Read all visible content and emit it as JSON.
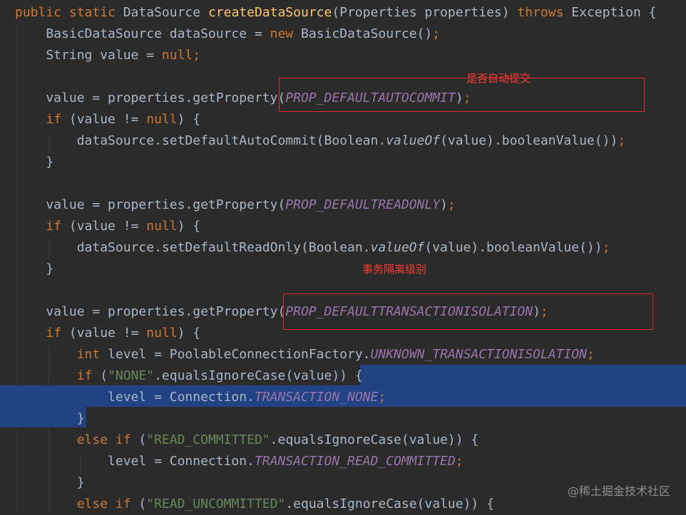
{
  "code_lines": [
    [
      {
        "t": "",
        "c": "pl"
      },
      {
        "t": "public static ",
        "c": "kw"
      },
      {
        "t": "DataSource ",
        "c": "pl"
      },
      {
        "t": "createDataSource",
        "c": "fn"
      },
      {
        "t": "(Properties properties) ",
        "c": "pl"
      },
      {
        "t": "throws ",
        "c": "kw"
      },
      {
        "t": "Exception {",
        "c": "pl"
      }
    ],
    [
      {
        "t": "    BasicDataSource dataSource = ",
        "c": "pl"
      },
      {
        "t": "new ",
        "c": "kw"
      },
      {
        "t": "BasicDataSource()",
        "c": "pl"
      },
      {
        "t": ";",
        "c": "kw"
      }
    ],
    [
      {
        "t": "    String value = ",
        "c": "pl"
      },
      {
        "t": "null;",
        "c": "kw"
      }
    ],
    [
      {
        "t": "",
        "c": "pl"
      }
    ],
    [
      {
        "t": "    value = properties.getProperty(",
        "c": "pl"
      },
      {
        "t": "PROP_DEFAULTAUTOCOMMIT",
        "c": "st"
      },
      {
        "t": ")",
        "c": "pl"
      },
      {
        "t": ";",
        "c": "kw"
      }
    ],
    [
      {
        "t": "    ",
        "c": "pl"
      },
      {
        "t": "if ",
        "c": "kw"
      },
      {
        "t": "(value != ",
        "c": "pl"
      },
      {
        "t": "null",
        "c": "kw"
      },
      {
        "t": ") {",
        "c": "pl"
      }
    ],
    [
      {
        "t": "        dataSource.setDefaultAutoCommit(Boolean.",
        "c": "pl"
      },
      {
        "t": "valueOf",
        "c": "mi"
      },
      {
        "t": "(value).booleanValue())",
        "c": "pl"
      },
      {
        "t": ";",
        "c": "kw"
      }
    ],
    [
      {
        "t": "    }",
        "c": "pl"
      }
    ],
    [
      {
        "t": "",
        "c": "pl"
      }
    ],
    [
      {
        "t": "    value = properties.getProperty(",
        "c": "pl"
      },
      {
        "t": "PROP_DEFAULTREADONLY",
        "c": "st"
      },
      {
        "t": ")",
        "c": "pl"
      },
      {
        "t": ";",
        "c": "kw"
      }
    ],
    [
      {
        "t": "    ",
        "c": "pl"
      },
      {
        "t": "if ",
        "c": "kw"
      },
      {
        "t": "(value != ",
        "c": "pl"
      },
      {
        "t": "null",
        "c": "kw"
      },
      {
        "t": ") {",
        "c": "pl"
      }
    ],
    [
      {
        "t": "        dataSource.setDefaultReadOnly(Boolean.",
        "c": "pl"
      },
      {
        "t": "valueOf",
        "c": "mi"
      },
      {
        "t": "(value).booleanValue())",
        "c": "pl"
      },
      {
        "t": ";",
        "c": "kw"
      }
    ],
    [
      {
        "t": "    }",
        "c": "pl"
      }
    ],
    [
      {
        "t": "",
        "c": "pl"
      }
    ],
    [
      {
        "t": "    value = properties.getProperty(",
        "c": "pl"
      },
      {
        "t": "PROP_DEFAULTTRANSACTIONISOLATION",
        "c": "st"
      },
      {
        "t": ")",
        "c": "pl"
      },
      {
        "t": ";",
        "c": "kw"
      }
    ],
    [
      {
        "t": "    ",
        "c": "pl"
      },
      {
        "t": "if ",
        "c": "kw"
      },
      {
        "t": "(value != ",
        "c": "pl"
      },
      {
        "t": "null",
        "c": "kw"
      },
      {
        "t": ") {",
        "c": "pl"
      }
    ],
    [
      {
        "t": "        ",
        "c": "pl"
      },
      {
        "t": "int ",
        "c": "kw"
      },
      {
        "t": "level = PoolableConnectionFactory.",
        "c": "pl"
      },
      {
        "t": "UNKNOWN_TRANSACTIONISOLATION",
        "c": "st"
      },
      {
        "t": ";",
        "c": "kw"
      }
    ],
    [
      {
        "t": "        ",
        "c": "pl"
      },
      {
        "t": "if ",
        "c": "kw"
      },
      {
        "t": "(",
        "c": "pl"
      },
      {
        "t": "\"NONE\"",
        "c": "sg"
      },
      {
        "t": ".equalsIgnoreCase(value)) {",
        "c": "pl"
      }
    ],
    [
      {
        "t": "            level = Connection.",
        "c": "pl"
      },
      {
        "t": "TRANSACTION_NONE",
        "c": "st"
      },
      {
        "t": ";",
        "c": "kw"
      }
    ],
    [
      {
        "t": "        }",
        "c": "pl"
      }
    ],
    [
      {
        "t": "        ",
        "c": "pl"
      },
      {
        "t": "else if ",
        "c": "kw"
      },
      {
        "t": "(",
        "c": "pl"
      },
      {
        "t": "\"READ_COMMITTED\"",
        "c": "sg"
      },
      {
        "t": ".equalsIgnoreCase(value)) {",
        "c": "pl"
      }
    ],
    [
      {
        "t": "            level = Connection.",
        "c": "pl"
      },
      {
        "t": "TRANSACTION_READ_COMMITTED",
        "c": "st"
      },
      {
        "t": ";",
        "c": "kw"
      }
    ],
    [
      {
        "t": "        }",
        "c": "pl"
      }
    ],
    [
      {
        "t": "        ",
        "c": "pl"
      },
      {
        "t": "else if ",
        "c": "kw"
      },
      {
        "t": "(",
        "c": "pl"
      },
      {
        "t": "\"READ_UNCOMMITTED\"",
        "c": "sg"
      },
      {
        "t": ".equalsIgnoreCase(value)) {",
        "c": "pl"
      }
    ]
  ],
  "annotations": {
    "autocommit_note": "是否自动提交",
    "isolation_note": "事务隔离级别"
  },
  "watermark": "@稀土掘金技术社区",
  "colors": {
    "background": "#2b2b2b",
    "keyword": "#cc7832",
    "method_decl": "#ffc66d",
    "static_field": "#9876aa",
    "string": "#6a8759",
    "text": "#a9b7c6",
    "selection": "#214283",
    "annotation_red": "#e0282a"
  }
}
